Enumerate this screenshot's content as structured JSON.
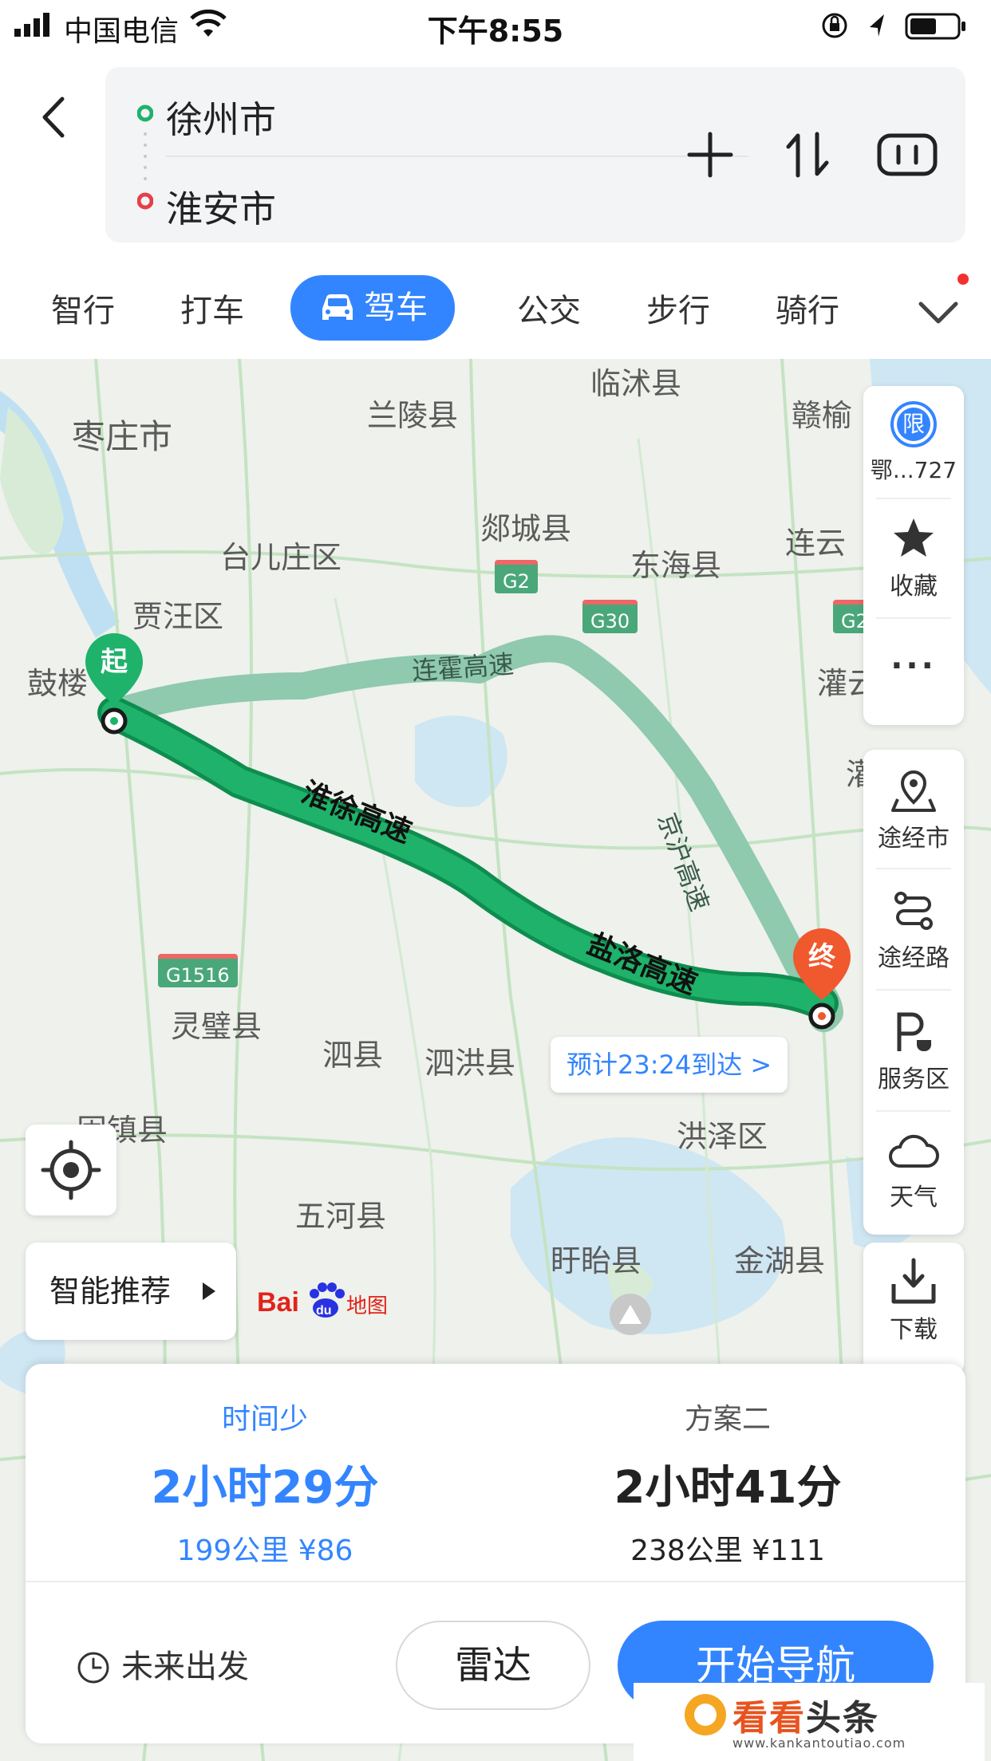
{
  "status_bar": {
    "carrier": "中国电信",
    "time": "下午8:55"
  },
  "route": {
    "from": "徐州市",
    "to": "淮安市"
  },
  "mode_tabs": [
    {
      "label": "智行"
    },
    {
      "label": "打车"
    },
    {
      "label": "驾车"
    },
    {
      "label": "公交"
    },
    {
      "label": "步行"
    },
    {
      "label": "骑行"
    }
  ],
  "map": {
    "labels": [
      "临沭县",
      "兰陵县",
      "枣庄市",
      "赣榆",
      "郯城县",
      "台儿庄区",
      "连云",
      "东海县",
      "贾汪区",
      "鼓楼",
      "灌云",
      "灵璧县",
      "泗县",
      "泗洪县",
      "洪泽区",
      "固镇县",
      "五河县",
      "盱眙县",
      "金湖县",
      "灌"
    ],
    "road_badges": [
      "G2",
      "G30",
      "G2",
      "G1516"
    ],
    "road_names": {
      "lianhuo": "连霍高速",
      "jinghu": "京沪高速",
      "huaixu": "淮徐高速",
      "yanluo": "盐洛高速"
    },
    "start_pin": "起",
    "end_pin": "终",
    "eta": "预计23:24到达 >",
    "brand_logo_text": "Bai地图"
  },
  "side_panel": {
    "limit_icon": "限",
    "plate": "鄂...727",
    "favorite": "收藏",
    "more": "···",
    "via_city": "途经市",
    "via_road": "途经路",
    "service_area": "服务区",
    "weather": "天气",
    "download": "下载"
  },
  "smart_recommend": "智能推荐",
  "plans": [
    {
      "tag": "时间少",
      "duration": "2小时29分",
      "meta": "199公里 ¥86"
    },
    {
      "tag": "方案二",
      "duration": "2小时41分",
      "meta": "238公里 ¥111"
    }
  ],
  "actions": {
    "future_departure": "未来出发",
    "radar": "雷达",
    "start_navigation": "开始导航"
  },
  "watermark": {
    "main_part1": "看看",
    "main_part2": "头条",
    "sub": "www.kankantoutiao.com"
  },
  "colors": {
    "primary": "#3385ff",
    "route_main": "#1fb26a",
    "route_alt": "#8fc9ae",
    "start_pin": "#1fb26a",
    "end_pin": "#f0582d"
  }
}
